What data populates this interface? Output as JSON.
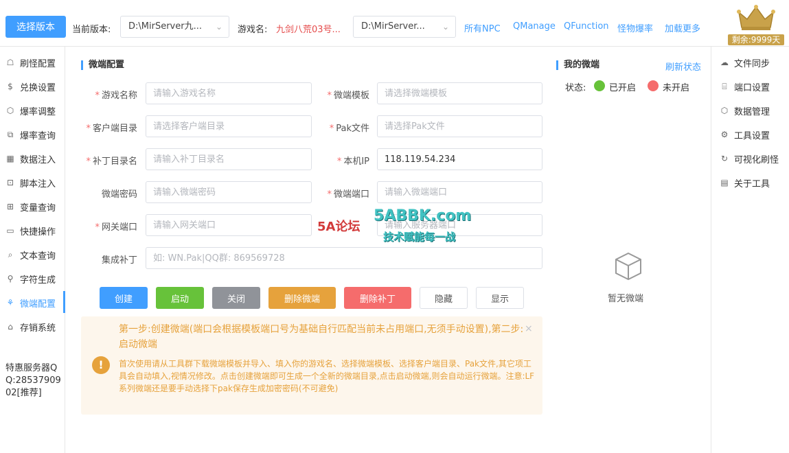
{
  "header": {
    "select_version_label": "选择版本",
    "current_version_label": "当前版本:",
    "current_version_value": "D:\\MirServer九...",
    "game_name_label": "游戏名:",
    "game_name_value": "九剑八荒03号...",
    "server_path_value": "D:\\MirServer...",
    "links": [
      "所有NPC",
      "QManage",
      "QFunction",
      "怪物爆率",
      "加载更多"
    ],
    "vip_remaining": "剩余:9999天"
  },
  "sidebar_left": {
    "items": [
      {
        "label": "刷怪配置",
        "icon": "monster-icon"
      },
      {
        "label": "兑换设置",
        "icon": "exchange-icon"
      },
      {
        "label": "爆率调整",
        "icon": "cube-icon"
      },
      {
        "label": "爆率查询",
        "icon": "query-icon"
      },
      {
        "label": "数据注入",
        "icon": "qrcode-icon"
      },
      {
        "label": "脚本注入",
        "icon": "script-icon"
      },
      {
        "label": "变量查询",
        "icon": "variable-icon"
      },
      {
        "label": "快捷操作",
        "icon": "folder-icon"
      },
      {
        "label": "文本查询",
        "icon": "search-icon"
      },
      {
        "label": "字符生成",
        "icon": "stamp-icon"
      },
      {
        "label": "微端配置",
        "icon": "client-icon"
      },
      {
        "label": "存销系统",
        "icon": "store-icon"
      }
    ],
    "active_index": 10,
    "info_text": "特惠服务器QQ:2853790902[推荐]"
  },
  "sidebar_right": {
    "items": [
      {
        "label": "文件同步",
        "icon": "cloud-upload-icon"
      },
      {
        "label": "端口设置",
        "icon": "bank-icon"
      },
      {
        "label": "数据管理",
        "icon": "cube-icon"
      },
      {
        "label": "工具设置",
        "icon": "gear-icon"
      },
      {
        "label": "可视化刷怪",
        "icon": "refresh-icon"
      },
      {
        "label": "关于工具",
        "icon": "clipboard-icon"
      }
    ]
  },
  "config": {
    "title": "微端配置",
    "fields": {
      "game_name": {
        "label": "游戏名称",
        "placeholder": "请输入游戏名称",
        "value": ""
      },
      "client_template": {
        "label": "微端模板",
        "placeholder": "请选择微端模板",
        "value": ""
      },
      "client_dir": {
        "label": "客户端目录",
        "placeholder": "请选择客户端目录",
        "value": ""
      },
      "pak_file": {
        "label": "Pak文件",
        "placeholder": "请选择Pak文件",
        "value": ""
      },
      "patch_dir": {
        "label": "补丁目录名",
        "placeholder": "请输入补丁目录名",
        "value": ""
      },
      "local_ip": {
        "label": "本机IP",
        "placeholder": "",
        "value": "118.119.54.234"
      },
      "client_password": {
        "label": "微端密码",
        "placeholder": "请输入微端密码",
        "value": ""
      },
      "client_port": {
        "label": "微端端口",
        "placeholder": "请输入微端端口",
        "value": ""
      },
      "gateway_port": {
        "label": "网关端口",
        "placeholder": "请输入网关端口",
        "value": ""
      },
      "server_port": {
        "label": "",
        "placeholder": "请输入服务器端口",
        "value": ""
      },
      "integrated_patch": {
        "label": "集成补丁",
        "placeholder": "如: WN.Pak|QQ群: 869569728",
        "value": ""
      }
    },
    "buttons": [
      {
        "label": "创建",
        "color": "#409eff"
      },
      {
        "label": "启动",
        "color": "#67c23a"
      },
      {
        "label": "关闭",
        "color": "#909399"
      },
      {
        "label": "删除微端",
        "color": "#e6a23c"
      },
      {
        "label": "删除补丁",
        "color": "#f56c6c"
      },
      {
        "label": "隐藏",
        "color": "#ffffff"
      },
      {
        "label": "显示",
        "color": "#ffffff"
      }
    ],
    "alert": {
      "title": "第一步:创建微端(端口会根据模板端口号为基础自行匹配当前未占用端口,无须手动设置),第二步:启动微端",
      "description": "首次使用请从工具群下载微端模板并导入、填入你的游戏名、选择微端模板、选择客户端目录、Pak文件,其它项工具会自动填入,视情况修改。点击创建微端即可生成一个全新的微端目录,点击启动微端,则会自动运行微端。注意:LF系列微端还是要手动选择下pak保存生成加密密码(不可避免)",
      "close": "×"
    }
  },
  "my_client": {
    "title": "我的微端",
    "refresh_label": "刷新状态",
    "status_label": "状态:",
    "status_on_label": "已开启",
    "status_off_label": "未开启",
    "status_on_color": "#67c23a",
    "status_off_color": "#f56c6c",
    "empty_text": "暂无微端"
  },
  "watermark": {
    "site": "5ABBK.com",
    "slogan": "技术赋能每一战",
    "forum": "5A论坛"
  }
}
